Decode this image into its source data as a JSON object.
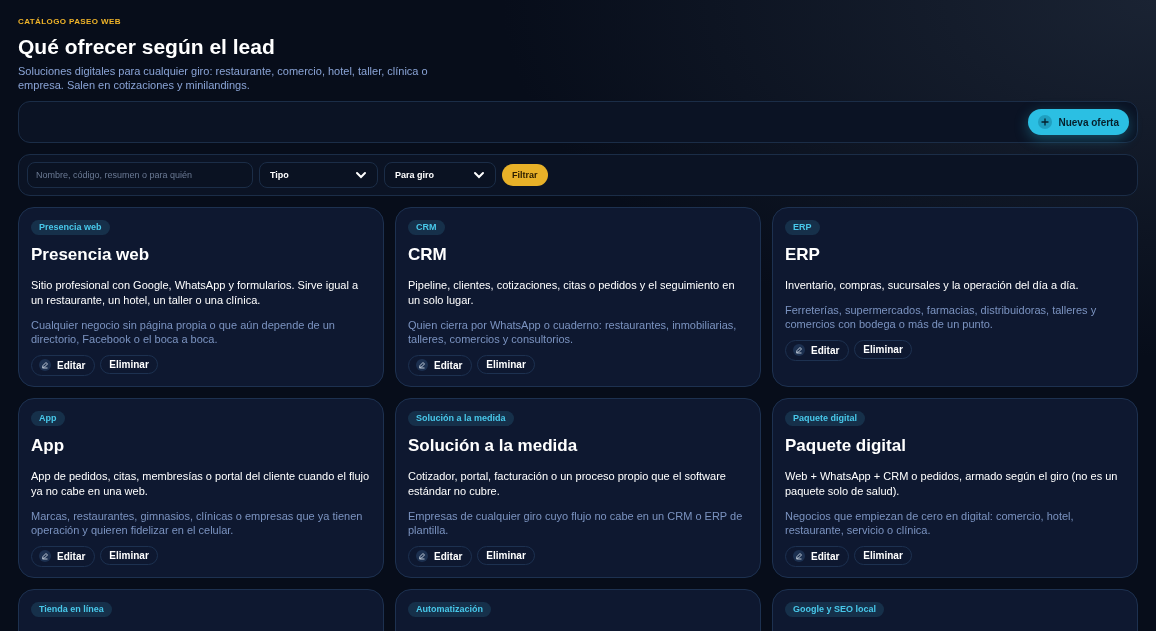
{
  "header": {
    "eyebrow": "CATÁLOGO PASEO WEB",
    "title": "Qué ofrecer según el lead",
    "subtitle": "Soluciones digitales para cualquier giro: restaurante, comercio, hotel, taller, clínica o empresa. Salen en cotizaciones y minilandings."
  },
  "toolbar": {
    "new_button": "Nueva oferta"
  },
  "filters": {
    "search": {
      "placeholder": "Nombre, código, resumen o para quién"
    },
    "type_select": "Tipo",
    "industry_select": "Para giro",
    "filter_button": "Filtrar"
  },
  "cards": [
    {
      "tag": "Presencia web",
      "title": "Presencia web",
      "summary": "Sitio profesional con Google, WhatsApp y formularios. Sirve igual a un restaurante, un hotel, un taller o una clínica.",
      "audience": "Cualquier negocio sin página propia o que aún depende de un directorio, Facebook o el boca a boca.",
      "edit": "Editar",
      "delete": "Eliminar"
    },
    {
      "tag": "CRM",
      "title": "CRM",
      "summary": "Pipeline, clientes, cotizaciones, citas o pedidos y el seguimiento en un solo lugar.",
      "audience": "Quien cierra por WhatsApp o cuaderno: restaurantes, inmobiliarias, talleres, comercios y consultorios.",
      "edit": "Editar",
      "delete": "Eliminar"
    },
    {
      "tag": "ERP",
      "title": "ERP",
      "summary": "Inventario, compras, sucursales y la operación del día a día.",
      "audience": "Ferreterías, supermercados, farmacias, distribuidoras, talleres y comercios con bodega o más de un punto.",
      "edit": "Editar",
      "delete": "Eliminar"
    },
    {
      "tag": "App",
      "title": "App",
      "summary": "App de pedidos, citas, membresías o portal del cliente cuando el flujo ya no cabe en una web.",
      "audience": "Marcas, restaurantes, gimnasios, clínicas o empresas que ya tienen operación y quieren fidelizar en el celular.",
      "edit": "Editar",
      "delete": "Eliminar"
    },
    {
      "tag": "Solución a la medida",
      "title": "Solución a la medida",
      "summary": "Cotizador, portal, facturación o un proceso propio que el software estándar no cubre.",
      "audience": "Empresas de cualquier giro cuyo flujo no cabe en un CRM o ERP de plantilla.",
      "edit": "Editar",
      "delete": "Eliminar"
    },
    {
      "tag": "Paquete digital",
      "title": "Paquete digital",
      "summary": "Web + WhatsApp + CRM o pedidos, armado según el giro (no es un paquete solo de salud).",
      "audience": "Negocios que empiezan de cero en digital: comercio, hotel, restaurante, servicio o clínica.",
      "edit": "Editar",
      "delete": "Eliminar"
    },
    {
      "tag": "Tienda en línea"
    },
    {
      "tag": "Automatización"
    },
    {
      "tag": "Google y SEO local"
    }
  ]
}
